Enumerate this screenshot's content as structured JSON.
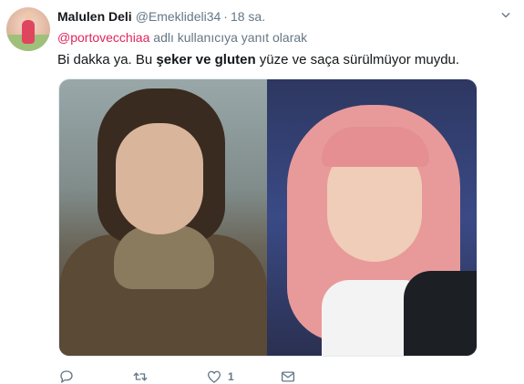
{
  "tweet": {
    "author_name": "Malulen Deli",
    "author_handle": "@Emeklideli34",
    "separator": "·",
    "time": "18 sa.",
    "reply_to_handle": "@portovecchiaa",
    "reply_suffix": " adlı kullanıcıya yanıt olarak",
    "text_part1": "Bi dakka ya. Bu ",
    "text_bold1": "şeker ve gluten",
    "text_part2": " yüze ve saça sürülmüyor muydu."
  },
  "actions": {
    "reply_count": "",
    "retweet_count": "",
    "like_count": "1",
    "dm_count": ""
  },
  "icons": {
    "caret": "chevron-down-icon",
    "reply": "reply-icon",
    "retweet": "retweet-icon",
    "like": "heart-icon",
    "dm": "envelope-icon"
  },
  "colors": {
    "mention": "#e0245e",
    "muted": "#657786",
    "text": "#14171a"
  }
}
